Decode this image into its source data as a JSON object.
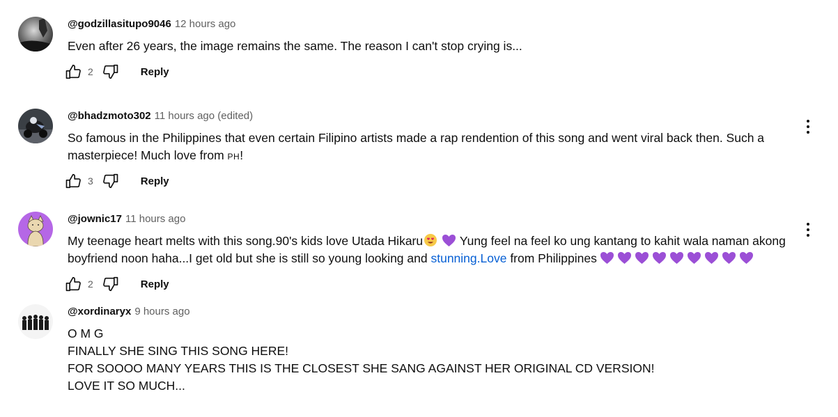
{
  "comments": [
    {
      "author": "@godzillasitupo9046",
      "time": "12 hours ago",
      "text_lines": [
        "Even after 26 years, the image remains the same. The reason I can't stop crying is..."
      ],
      "likes": "2",
      "reply_label": "Reply",
      "avatar": "dark-grayscale-photo"
    },
    {
      "author": "@bhadzmoto302",
      "time": "11 hours ago (edited)",
      "line1": "So famous in the Philippines that even certain Filipino artists made a rap rendention of this song and went viral back then. Such a",
      "line2_a": "masterpiece! Much love from ",
      "flag": "PH",
      "line2_b": "!",
      "likes": "3",
      "reply_label": "Reply",
      "avatar": "motorcycle-photo"
    },
    {
      "author": "@jownic17",
      "time": "11 hours ago",
      "line1_a": "My teenage heart melts with this song.90's kids love Utada Hikaru",
      "line1_b": "Yung feel na feel ko ung kantang to kahit wala naman akong",
      "line2_a": "boyfriend noon haha...I get old but she is still so young looking and ",
      "line2_link": "stunning.Love",
      "line2_b": " from Philippines",
      "likes": "2",
      "reply_label": "Reply",
      "avatar": "cat-illustration-purple",
      "emojis": [
        "heart-eyes-emoji",
        "purple-heart-emoji"
      ]
    },
    {
      "author": "@xordinaryx",
      "time": "9 hours ago",
      "text_lines": [
        "O M G",
        "FINALLY SHE SING THIS SONG HERE!",
        "FOR SOOOO MANY YEARS THIS IS THE CLOSEST SHE SANG AGAINST HER ORIGINAL CD VERSION!",
        "LOVE IT SO MUCH..."
      ],
      "avatar": "group-photo"
    }
  ],
  "icons": {
    "like": "thumbs-up-icon",
    "dislike": "thumbs-down-icon",
    "more": "more-vert-icon"
  },
  "colors": {
    "text": "#0f0f0f",
    "secondary": "#606060",
    "link": "#065fd4",
    "heart": "#9b4fd6"
  }
}
